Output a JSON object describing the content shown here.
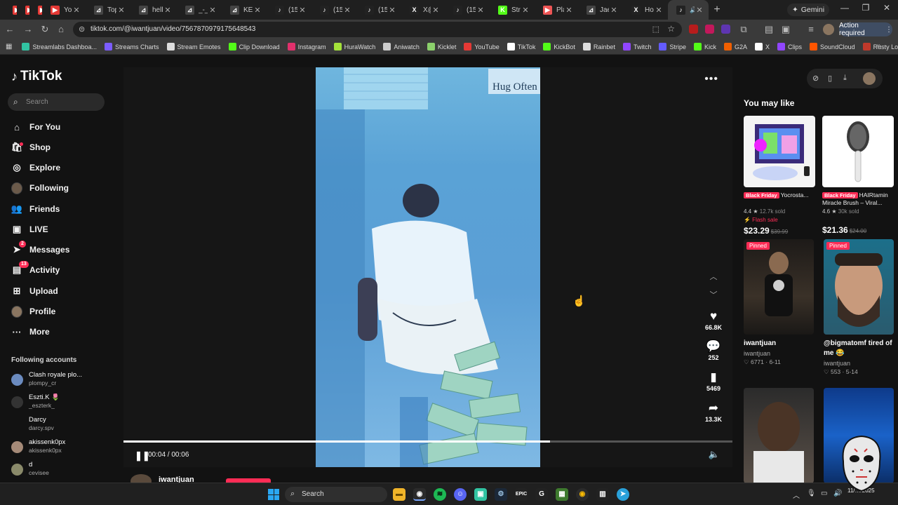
{
  "browser": {
    "tabs": [
      {
        "title": "",
        "icon": "youtube-red-icon",
        "color": "#e53935",
        "active": false,
        "close": false,
        "width": 16
      },
      {
        "title": "",
        "icon": "youtube-red-icon",
        "color": "#e53935",
        "active": false,
        "close": false,
        "width": 16
      },
      {
        "title": "",
        "icon": "youtube-red-icon",
        "color": "#e53935",
        "active": false,
        "close": false,
        "width": 16
      },
      {
        "title": "YouT",
        "icon": "youtube-icon",
        "color": "#e53935",
        "active": false,
        "close": true,
        "width": 62
      },
      {
        "title": "Top",
        "icon": "streamable-icon",
        "color": "#444",
        "active": false,
        "close": true,
        "width": 64
      },
      {
        "title": "hello",
        "icon": "streamable-icon",
        "color": "#444",
        "active": false,
        "close": true,
        "width": 66
      },
      {
        "title": "_-_-",
        "icon": "streamable-icon",
        "color": "#444",
        "active": false,
        "close": true,
        "width": 64
      },
      {
        "title": "KEEN",
        "icon": "streamable-icon",
        "color": "#444",
        "active": false,
        "close": true,
        "width": 64
      },
      {
        "title": "(15)",
        "icon": "tiktok-icon",
        "color": "#222",
        "active": false,
        "close": true,
        "width": 64
      },
      {
        "title": "(15)",
        "icon": "tiktok-icon",
        "color": "#222",
        "active": false,
        "close": true,
        "width": 64
      },
      {
        "title": "(15)",
        "icon": "tiktok-icon",
        "color": "#222",
        "active": false,
        "close": true,
        "width": 64
      },
      {
        "title": "X@",
        "icon": "x-icon",
        "color": "#222",
        "active": false,
        "close": true,
        "width": 62
      },
      {
        "title": "(15)",
        "icon": "tiktok-icon",
        "color": "#222",
        "active": false,
        "close": true,
        "width": 64
      },
      {
        "title": "Strea",
        "icon": "kick-icon",
        "color": "#53fc18",
        "active": false,
        "close": true,
        "width": 64
      },
      {
        "title": "Play",
        "icon": "play-icon",
        "color": "#e55",
        "active": false,
        "close": true,
        "width": 62
      },
      {
        "title": "Jae",
        "icon": "streamable-icon",
        "color": "#444",
        "active": false,
        "close": true,
        "width": 64
      },
      {
        "title": "Hom",
        "icon": "x-icon",
        "color": "#222",
        "active": false,
        "close": true,
        "width": 64
      },
      {
        "title": "",
        "icon": "tiktok-icon",
        "color": "#222",
        "active": true,
        "close": true,
        "width": 58
      }
    ],
    "gemini_label": "Gemini",
    "url": "tiktok.com/@iwantjuan/video/7567870979175648543",
    "action_required": "Action required",
    "bookmarks": [
      {
        "label": "Streamlabs Dashboa...",
        "color": "#31c3a2"
      },
      {
        "label": "Streams Charts",
        "color": "#7b5cff"
      },
      {
        "label": "Stream Emotes",
        "color": "#ddd"
      },
      {
        "label": "Clip Download",
        "color": "#53fc18"
      },
      {
        "label": "Instagram",
        "color": "#e1306c"
      },
      {
        "label": "HuraWatch",
        "color": "#a4e23a"
      },
      {
        "label": "Aniwatch",
        "color": "#ccc"
      },
      {
        "label": "Kicklet",
        "color": "#8bd06b"
      },
      {
        "label": "YouTube",
        "color": "#e53935"
      },
      {
        "label": "TikTok",
        "color": "#fff"
      },
      {
        "label": "KickBot",
        "color": "#53fc18"
      },
      {
        "label": "Rainbet",
        "color": "#ddd"
      },
      {
        "label": "Twitch",
        "color": "#9146ff"
      },
      {
        "label": "Stripe",
        "color": "#635bff"
      },
      {
        "label": "Kick",
        "color": "#53fc18"
      },
      {
        "label": "G2A",
        "color": "#f05f00"
      },
      {
        "label": "X",
        "color": "#fff"
      },
      {
        "label": "Clips",
        "color": "#9146ff"
      },
      {
        "label": "SoundCloud",
        "color": "#ff5500"
      },
      {
        "label": "Rusty Loot",
        "color": "#c0392b"
      }
    ]
  },
  "tiktok": {
    "brand": "TikTok",
    "search_placeholder": "Search",
    "nav": [
      {
        "label": "For You",
        "icon": "home-icon",
        "glyph": "⌂"
      },
      {
        "label": "Shop",
        "icon": "shop-bag-icon",
        "glyph": "🛍"
      },
      {
        "label": "Explore",
        "icon": "compass-icon",
        "glyph": "◎"
      },
      {
        "label": "Following",
        "icon": "following-avatar-icon",
        "glyph": "●"
      },
      {
        "label": "Friends",
        "icon": "friends-icon",
        "glyph": "👥"
      },
      {
        "label": "LIVE",
        "icon": "live-icon",
        "glyph": "▣"
      },
      {
        "label": "Messages",
        "icon": "messages-icon",
        "glyph": "➤",
        "badge": "2"
      },
      {
        "label": "Activity",
        "icon": "activity-icon",
        "glyph": "▤",
        "badge": "13"
      },
      {
        "label": "Upload",
        "icon": "upload-icon",
        "glyph": "⊞"
      },
      {
        "label": "Profile",
        "icon": "profile-avatar-icon",
        "glyph": "●"
      },
      {
        "label": "More",
        "icon": "more-icon",
        "glyph": "···"
      }
    ],
    "following_title": "Following accounts",
    "following": [
      {
        "name": "Clash royale plo...",
        "user": "plompy_cr",
        "color": "#6b8bbf"
      },
      {
        "name": "Eszti.K 🌷",
        "user": "_eszterk_",
        "color": "#333"
      },
      {
        "name": "Darcy",
        "user": "darcy.spv",
        "color": "#121212"
      },
      {
        "name": "akissenk0px",
        "user": "akissenk0px",
        "color": "#a58a78"
      },
      {
        "name": "d",
        "user": "cevisee",
        "color": "#8a8a6a"
      }
    ],
    "player": {
      "current": "00:04",
      "duration": "00:06",
      "progress_fraction": 0.7,
      "wall_text": "Hug Often",
      "likes": "66.8K",
      "comments": "252",
      "saves": "5469",
      "shares": "13.3K",
      "author": "iwantjuan"
    },
    "rail": {
      "title": "You may like",
      "products": [
        {
          "badge": "Black Friday",
          "title": "Yocrosta...",
          "rating": "4.4 ★",
          "sold": "12.7k sold",
          "flash": "⚡ Flash sale",
          "price": "$23.29",
          "old": "$39.99"
        },
        {
          "badge": "Black Friday",
          "title": "HAIRtamin Miracle Brush – Viral...",
          "rating": "4.6 ★",
          "sold": "30k sold",
          "flash": "",
          "price": "$21.36",
          "old": "$24.00"
        }
      ],
      "videos": [
        {
          "pinned": "Pinned",
          "title": "iwantjuan",
          "author": "iwantjuan",
          "stats": "♡ 6771 · 6-11"
        },
        {
          "pinned": "Pinned",
          "title": "@bigmatomf tired of me 😂",
          "author": "iwantjuan",
          "stats": "♡ 553 · 5-14"
        }
      ]
    }
  },
  "taskbar": {
    "search_label": "Search",
    "time": "",
    "date": "11/…/2025"
  }
}
